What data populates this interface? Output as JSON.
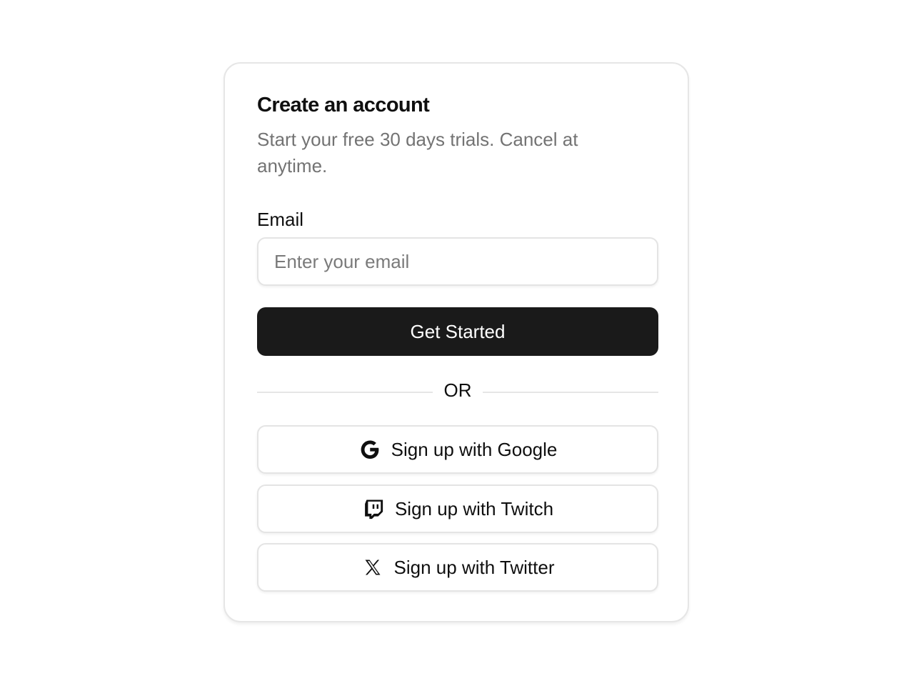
{
  "signup": {
    "title": "Create an account",
    "subtitle": "Start your free 30 days trials. Cancel at anytime.",
    "email": {
      "label": "Email",
      "placeholder": "Enter your email",
      "value": ""
    },
    "primary_button": "Get Started",
    "divider_text": "OR",
    "social_buttons": [
      {
        "label": "Sign up with Google",
        "icon": "google-icon"
      },
      {
        "label": "Sign up with Twitch",
        "icon": "twitch-icon"
      },
      {
        "label": "Sign up with Twitter",
        "icon": "x-twitter-icon"
      }
    ]
  },
  "colors": {
    "primary_button_bg": "#1a1a1a",
    "primary_button_text": "#ffffff",
    "muted_text": "#737373",
    "border": "#e4e4e4"
  }
}
